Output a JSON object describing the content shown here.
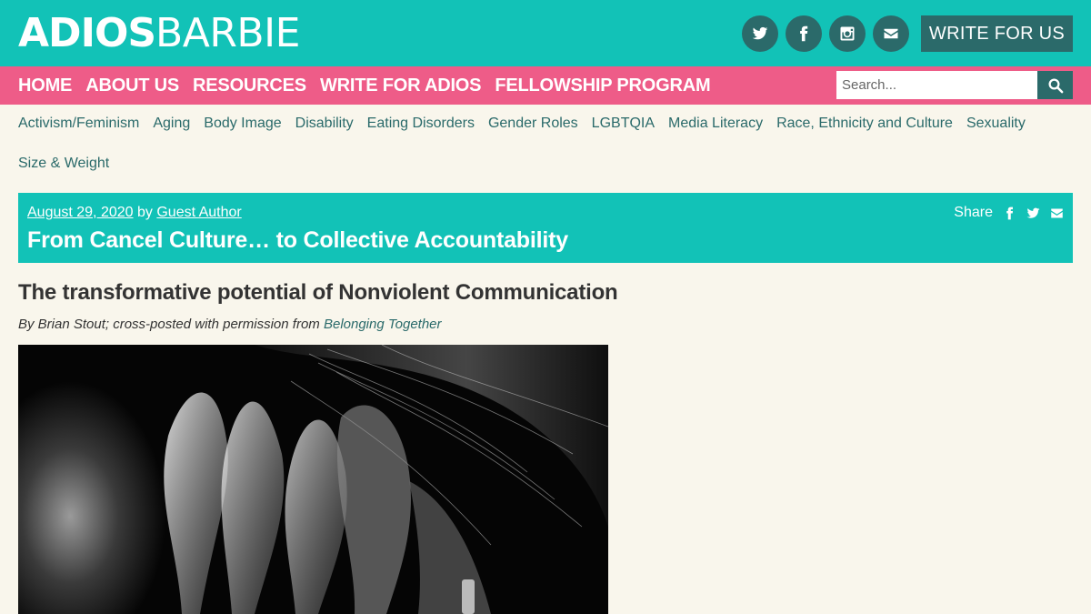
{
  "header": {
    "logo_bold": "ADIOS",
    "logo_thin": "BARBIE",
    "social": [
      "twitter-icon",
      "facebook-icon",
      "instagram-icon",
      "envelope-icon"
    ],
    "write_button": "WRITE FOR US",
    "colors": {
      "teal": "#12c2b7",
      "dark_teal": "#2b6a6a",
      "pink": "#ee5c88"
    }
  },
  "nav": {
    "items": [
      "HOME",
      "ABOUT US",
      "RESOURCES",
      "WRITE FOR ADIOS",
      "FELLOWSHIP PROGRAM"
    ],
    "search_placeholder": "Search..."
  },
  "categories": [
    "Activism/Feminism",
    "Aging",
    "Body Image",
    "Disability",
    "Eating Disorders",
    "Gender Roles",
    "LGBTQIA",
    "Media Literacy",
    "Race, Ethnicity and Culture",
    "Sexuality",
    "Size & Weight"
  ],
  "article": {
    "date": "August 29, 2020",
    "by": "by",
    "author": "Guest Author",
    "share_label": "Share",
    "title": "From Cancel Culture… to Collective Accountability",
    "subtitle": "The transformative potential of Nonviolent Communication",
    "byline_text": "By Brian Stout; cross-posted with permission from",
    "byline_link": "Belonging Together"
  }
}
